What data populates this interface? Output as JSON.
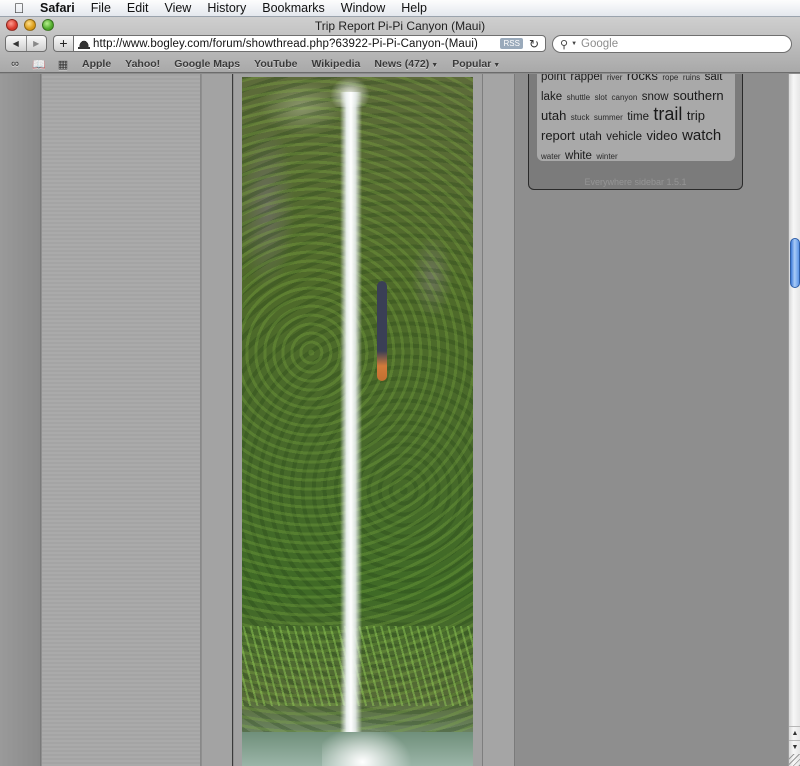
{
  "menubar": {
    "apple_icon": "apple-logo",
    "items": [
      "Safari",
      "File",
      "Edit",
      "View",
      "History",
      "Bookmarks",
      "Window",
      "Help"
    ]
  },
  "window": {
    "title": "Trip Report Pi-Pi Canyon (Maui)"
  },
  "toolbar": {
    "back_icon": "◀",
    "forward_icon": "▶",
    "add_icon": "+",
    "url": "http://www.bogley.com/forum/showthread.php?63922-Pi-Pi-Canyon-(Maui)",
    "rss_label": "RSS",
    "reload_icon": "↻",
    "search_placeholder": "Google"
  },
  "bookmarks": {
    "icons": [
      "reading-glasses-icon",
      "book-icon",
      "grid-icon"
    ],
    "items": [
      {
        "label": "Apple"
      },
      {
        "label": "Yahoo!"
      },
      {
        "label": "Google Maps"
      },
      {
        "label": "YouTube"
      },
      {
        "label": "Wikipedia"
      },
      {
        "label": "News (472)",
        "has_menu": true
      },
      {
        "label": "Popular",
        "has_menu": true
      }
    ]
  },
  "content": {
    "photo_alt": "Person rappelling beside waterfall in Pi-Pi Canyon, Maui"
  },
  "tag_cloud": {
    "tags": [
      {
        "text": "point",
        "size": 3
      },
      {
        "text": "rappel",
        "size": 3
      },
      {
        "text": "river",
        "size": 1
      },
      {
        "text": "rocks",
        "size": 4
      },
      {
        "text": "rope",
        "size": 1
      },
      {
        "text": "ruins",
        "size": 1
      },
      {
        "text": "salt",
        "size": 3
      },
      {
        "text": "lake",
        "size": 3
      },
      {
        "text": "shuttle",
        "size": 1
      },
      {
        "text": "slot",
        "size": 1
      },
      {
        "text": "canyon",
        "size": 1
      },
      {
        "text": "snow",
        "size": 3
      },
      {
        "text": "southern",
        "size": 4
      },
      {
        "text": "utah",
        "size": 4
      },
      {
        "text": "stuck",
        "size": 1
      },
      {
        "text": "summer",
        "size": 1
      },
      {
        "text": "time",
        "size": 3
      },
      {
        "text": "trail",
        "size": 6
      },
      {
        "text": "trip",
        "size": 4
      },
      {
        "text": "report",
        "size": 4
      },
      {
        "text": "utah",
        "size": 3
      },
      {
        "text": "vehicle",
        "size": 3
      },
      {
        "text": "video",
        "size": 4
      },
      {
        "text": "watch",
        "size": 5
      },
      {
        "text": "water",
        "size": 1
      },
      {
        "text": "white",
        "size": 3
      },
      {
        "text": "winter",
        "size": 1
      }
    ],
    "footer": "Everywhere sidebar 1.5.1"
  },
  "scrollbar": {
    "position_fraction": 0.25,
    "up_icon": "▲",
    "down_icon": "▼"
  }
}
